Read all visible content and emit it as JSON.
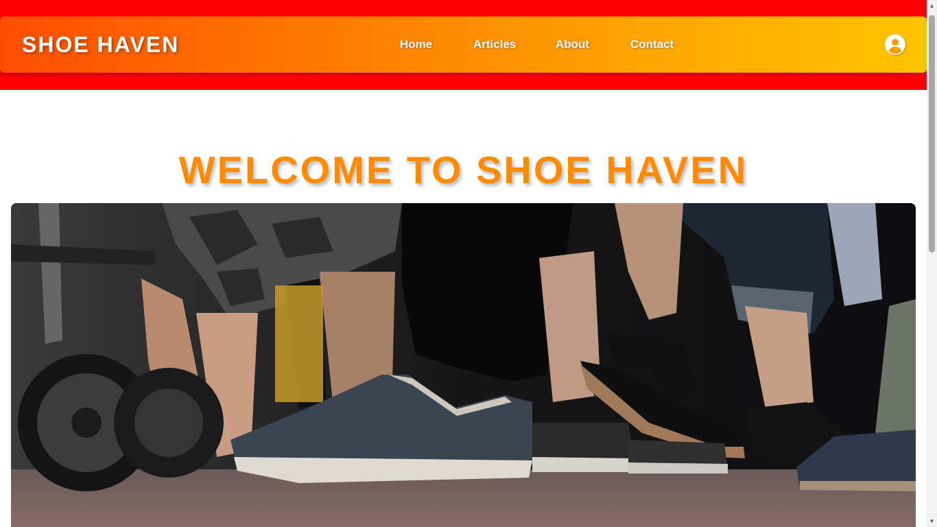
{
  "colors": {
    "top_band": "#ff0000",
    "nav_gradient_start": "#ff4d00",
    "nav_gradient_end": "#ffc400",
    "title_orange": "#ff8c00",
    "nav_text": "#ffffff"
  },
  "header": {
    "brand": "SHOE HAVEN",
    "nav": [
      {
        "label": "Home"
      },
      {
        "label": "Articles"
      },
      {
        "label": "About"
      },
      {
        "label": "Contact"
      }
    ],
    "user_icon": "user-circle-icon"
  },
  "main": {
    "title": "WELCOME TO SHOE HAVEN",
    "hero_image": "street-crowd-shoes-photo"
  },
  "scrollbar": {
    "up_icon": "triangle-up-icon",
    "down_icon": "triangle-down-icon",
    "position": 0
  }
}
